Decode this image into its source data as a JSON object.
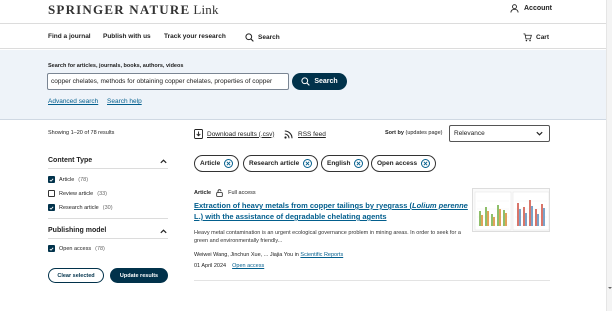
{
  "header": {
    "logo_main": "SPRINGER NATURE",
    "logo_link": "Link",
    "account_label": "Account"
  },
  "nav": {
    "find_journal": "Find a journal",
    "publish": "Publish with us",
    "track": "Track your research",
    "search": "Search",
    "cart": "Cart"
  },
  "search": {
    "label": "Search for articles, journals, books, authors, videos",
    "value": "copper chelates, methods for obtaining copper chelates, properties of copper",
    "button": "Search",
    "advanced": "Advanced search",
    "help": "Search help"
  },
  "results": {
    "showing": "Showing 1–20 of 78 results",
    "download": "Download results (.csv)",
    "rss": "RSS feed",
    "sort_label": "Sort by",
    "sort_note": "(updates page)",
    "sort_value": "Relevance"
  },
  "filters": {
    "content_type_title": "Content Type",
    "content_type": [
      {
        "label": "Article",
        "count": "(78)",
        "checked": true
      },
      {
        "label": "Review article",
        "count": "(33)",
        "checked": false
      },
      {
        "label": "Research article",
        "count": "(30)",
        "checked": true
      }
    ],
    "publishing_title": "Publishing model",
    "publishing": [
      {
        "label": "Open access",
        "count": "(78)",
        "checked": true
      }
    ],
    "clear": "Clear selected",
    "update": "Update results"
  },
  "chips": [
    "Article",
    "Research article",
    "English",
    "Open access"
  ],
  "result1": {
    "type": "Article",
    "access": "Full access",
    "title_a": "Extraction of heavy metals from copper tailings by ryegrass (",
    "title_i": "Lolium perenne",
    "title_b": " L.) with the assistance of degradable chelating agents",
    "snippet": "Heavy metal contamination is an urgent ecological governance problem in mining areas. In order to seek for a green and environmentally friendly...",
    "authors": "Weiwei Wang, Jinchun Xue, ... Jiajia You in ",
    "journal": "Scientific Reports",
    "date": "01 April 2024",
    "oa": "Open access"
  },
  "colors": {
    "primary": "#01324b",
    "link": "#025e8d",
    "band": "#eef3f9"
  }
}
